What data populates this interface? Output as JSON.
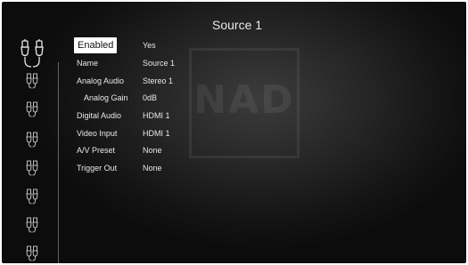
{
  "header": {
    "title": "Source 1"
  },
  "watermark": {
    "brand": "NAD"
  },
  "sidebar": {
    "icons": [
      {
        "name": "source-1-rca-icon",
        "selected": true
      },
      {
        "name": "source-2-rca-icon",
        "selected": false
      },
      {
        "name": "source-3-rca-icon",
        "selected": false
      },
      {
        "name": "source-4-rca-icon",
        "selected": false
      },
      {
        "name": "source-5-rca-icon",
        "selected": false
      },
      {
        "name": "source-6-rca-icon",
        "selected": false
      },
      {
        "name": "source-7-rca-icon",
        "selected": false
      },
      {
        "name": "source-8-rca-icon",
        "selected": false
      },
      {
        "name": "source-9-rca-icon",
        "selected": false
      }
    ]
  },
  "settings": [
    {
      "label": "Enabled",
      "value": "Yes"
    },
    {
      "label": "Name",
      "value": "Source 1"
    },
    {
      "label": "Analog Audio",
      "value": "Stereo 1"
    },
    {
      "label": "Analog Gain",
      "value": "0dB"
    },
    {
      "label": "Digital Audio",
      "value": "HDMI 1"
    },
    {
      "label": "Video Input",
      "value": "HDMI 1"
    },
    {
      "label": "A/V Preset",
      "value": "None"
    },
    {
      "label": "Trigger Out",
      "value": "None"
    }
  ],
  "colors": {
    "text": "#e8e8e8",
    "highlight_bg": "#ffffff",
    "highlight_text": "#111111"
  }
}
